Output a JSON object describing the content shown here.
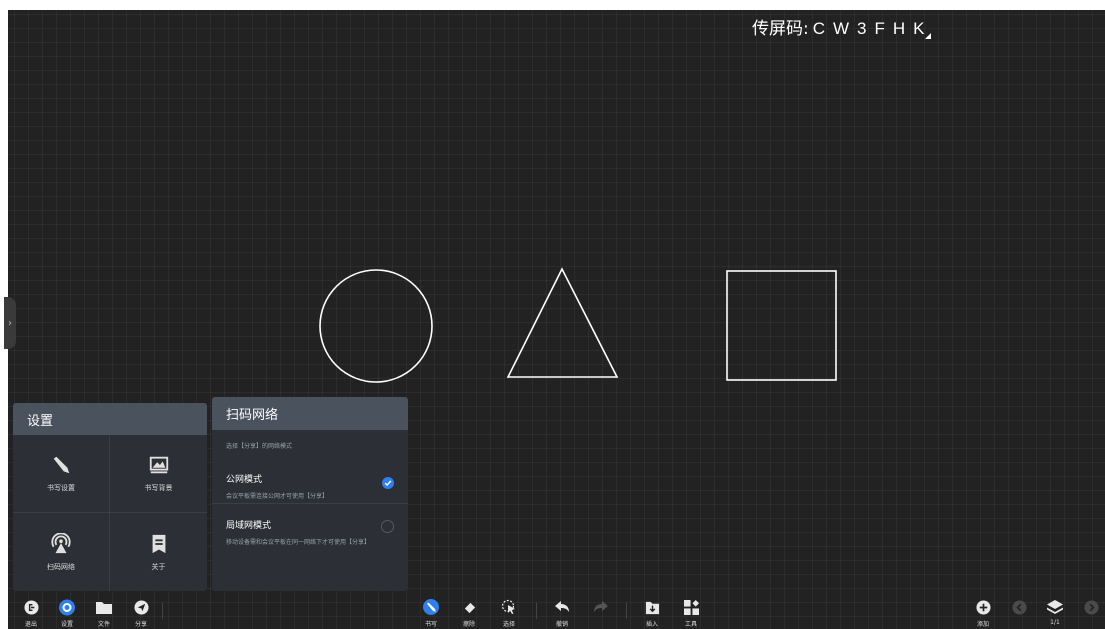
{
  "cast_code": {
    "label": "传屏码:",
    "code": "CW3FHK"
  },
  "settings_panel": {
    "title": "设置",
    "items": [
      {
        "label": "书写设置",
        "icon": "pen-icon"
      },
      {
        "label": "书写背景",
        "icon": "image-icon"
      },
      {
        "label": "扫码网络",
        "icon": "signal-icon"
      },
      {
        "label": "关于",
        "icon": "bookmark-icon"
      }
    ]
  },
  "network_panel": {
    "title": "扫码网络",
    "description": "选择【分享】的网络模式",
    "options": [
      {
        "title": "公网模式",
        "subtitle": "会议平板需连接公网才可使用【分享】",
        "selected": true
      },
      {
        "title": "局域网模式",
        "subtitle": "移动设备需和会议平板在同一网络下才可使用【分享】",
        "selected": false
      }
    ]
  },
  "toolbar": {
    "left": [
      {
        "label": "退出",
        "icon": "exit-icon"
      },
      {
        "label": "设置",
        "icon": "settings-icon"
      },
      {
        "label": "文件",
        "icon": "folder-icon"
      },
      {
        "label": "分享",
        "icon": "share-icon"
      }
    ],
    "center": [
      {
        "label": "书写",
        "icon": "pen-icon"
      },
      {
        "label": "擦除",
        "icon": "eraser-icon"
      },
      {
        "label": "选择",
        "icon": "select-icon"
      },
      {
        "label": "撤销",
        "icon": "undo-icon"
      },
      {
        "label": "",
        "icon": "redo-icon"
      },
      {
        "label": "插入",
        "icon": "insert-icon"
      },
      {
        "label": "工具",
        "icon": "tools-icon"
      }
    ],
    "right": [
      {
        "label": "添加",
        "icon": "add-icon"
      },
      {
        "label": "",
        "icon": "prev-icon"
      },
      {
        "label": "1/1",
        "icon": "layers-icon"
      },
      {
        "label": "",
        "icon": "next-icon"
      }
    ]
  },
  "colors": {
    "background": "#222222",
    "accent": "#2f80ed",
    "panel": "#2c2f35",
    "panel_header": "#4a525e"
  }
}
